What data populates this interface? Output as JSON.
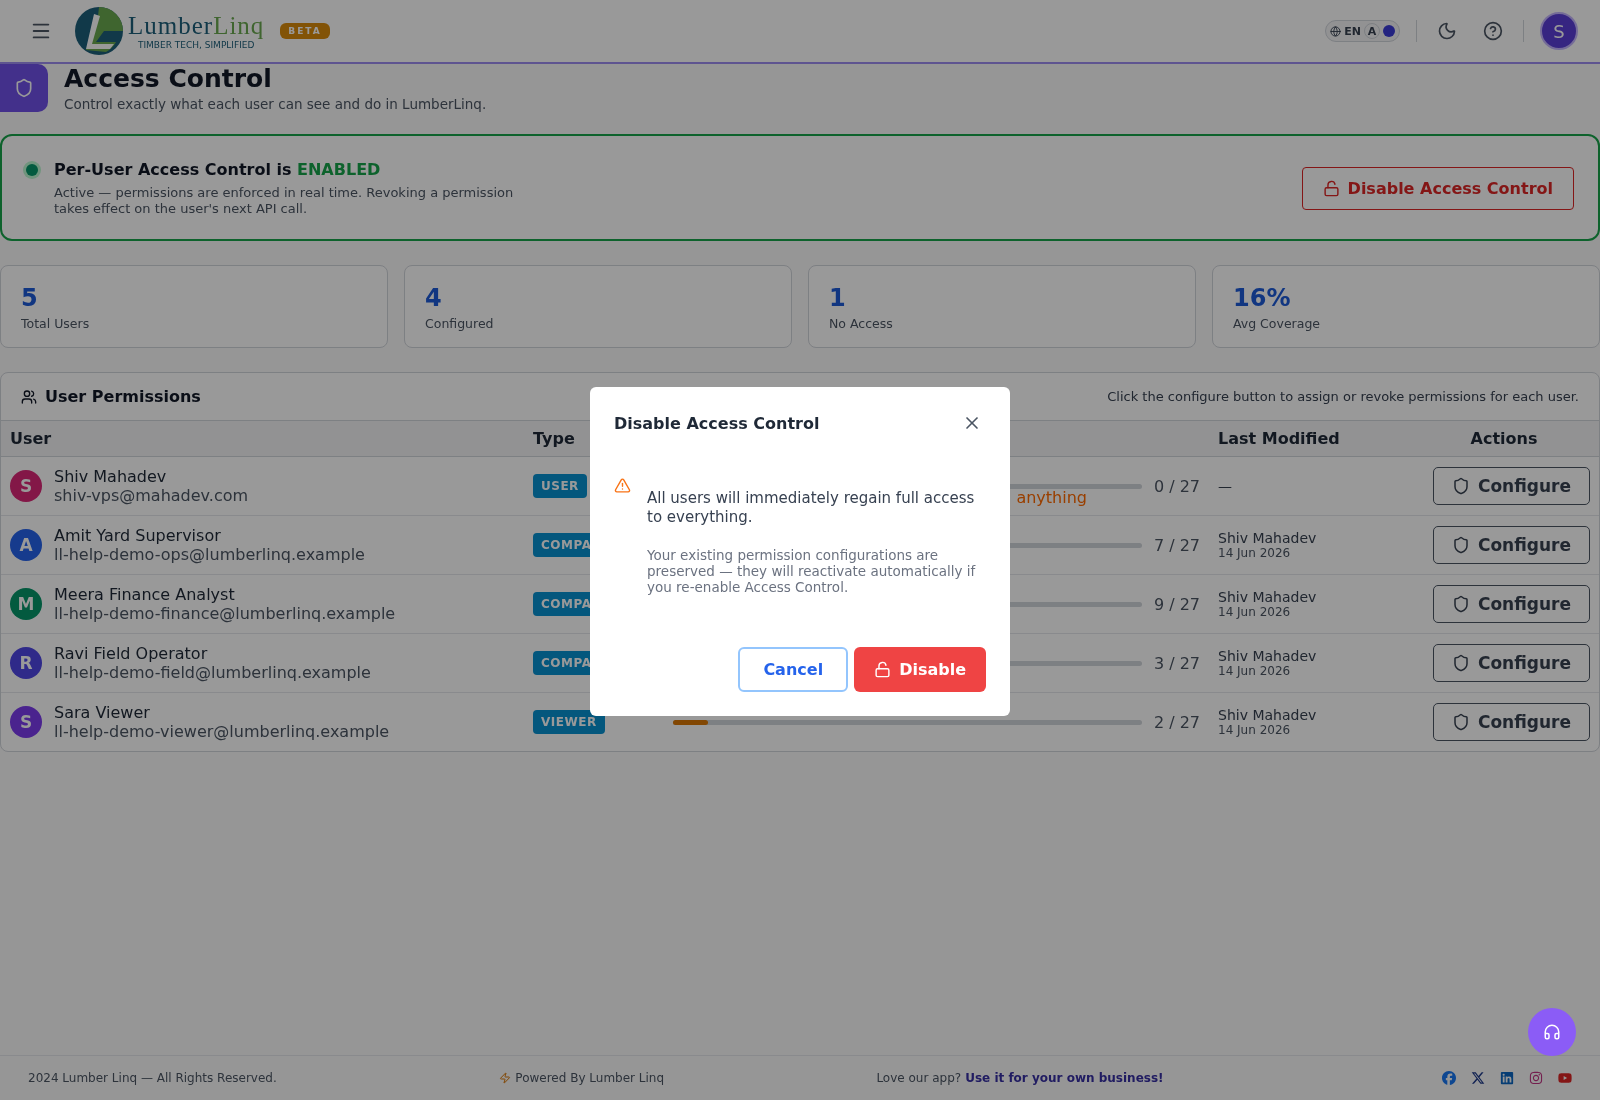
{
  "header": {
    "brand": {
      "word_1": "Lumber",
      "word_2": "Linq",
      "tagline": "TIMBER TECH, SIMPLIFIED"
    },
    "badge": "BETA",
    "language": {
      "code": "EN",
      "font_toggle": "A",
      "on": true
    },
    "avatar": "S"
  },
  "page": {
    "title": "Access Control",
    "subtitle": "Control exactly what each user can see and do in LumberLinq."
  },
  "status_card": {
    "enabled": true,
    "title": "Per-User Access Control is **ENABLED**",
    "description": "Active — permissions are enforced in real time. Revoking a permission takes effect on the user's next API call.",
    "button": "Disable Access Control"
  },
  "stats": [
    {
      "value": "5",
      "label": "Total Users"
    },
    {
      "value": "4",
      "label": "Configured"
    },
    {
      "value": "1",
      "label": "No Access"
    },
    {
      "value": "16%",
      "label": "Avg Coverage"
    }
  ],
  "permissions": {
    "title": "User Permissions",
    "hint": "Click the configure button to assign or revoke permissions for each user.",
    "columns": [
      "User",
      "Type",
      "Last Modified",
      "Actions"
    ],
    "rows": [
      {
        "initial": "S",
        "color": "#831747",
        "name": "Shiv Mahadev",
        "email": "shiv-vps@mahadev.com",
        "type": "USER",
        "note": "anything",
        "count": "0 / 27",
        "modified_by": "—",
        "action": "Configure"
      },
      {
        "initial": "A",
        "color": "#163b8d",
        "name": "Amit Yard Supervisor",
        "email": "ll-help-demo-ops@lumberlinq.example",
        "type": "COMPA",
        "count": "7 / 27",
        "modified_by": "Shiv Mahadev",
        "modified_on": "14 Jun 2026",
        "action": "Configure"
      },
      {
        "initial": "M",
        "color": "#035a3f",
        "name": "Meera Finance Analyst",
        "email": "ll-help-demo-finance@lumberlinq.example",
        "type": "COMPA",
        "count": "9 / 27",
        "modified_by": "Shiv Mahadev",
        "modified_on": "14 Jun 2026",
        "action": "Configure"
      },
      {
        "initial": "R",
        "color": "#2f2a89",
        "name": "Ravi Field Operator",
        "email": "ll-help-demo-field@lumberlinq.example",
        "type": "COMPA",
        "count": "3 / 27",
        "modified_by": "Shiv Mahadev",
        "modified_on": "14 Jun 2026",
        "action": "Configure"
      },
      {
        "initial": "S",
        "color": "#4a238e",
        "name": "Sara Viewer",
        "email": "ll-help-demo-viewer@lumberlinq.example",
        "type": "VIEWER",
        "level": 0.074,
        "count": "2 / 27",
        "modified_by": "Shiv Mahadev",
        "modified_on": "14 Jun 2026",
        "action": "Configure"
      }
    ]
  },
  "dialog": {
    "title": "Disable Access Control",
    "message": "All users will immediately regain full access to everything.",
    "detail": "Your existing permission configurations are preserved — they will reactivate automatically if you re-enable Access Control.",
    "buttons": [
      {
        "kind": "secondary",
        "label": "Cancel"
      },
      {
        "kind": "danger",
        "label": "Disable"
      }
    ]
  },
  "footer": {
    "copyright": "2024 Lumber Linq — All Rights Reserved.",
    "powered": "Powered By Lumber Linq",
    "promo": "Love our app?",
    "promo_link": "Use it for your own business!"
  }
}
